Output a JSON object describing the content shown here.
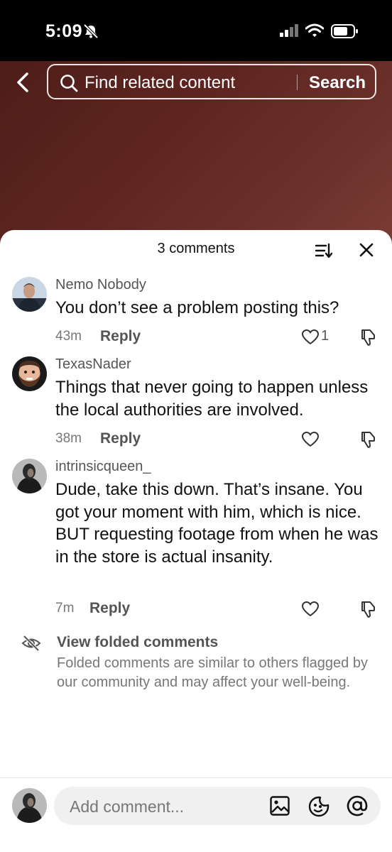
{
  "status_bar": {
    "time": "5:09"
  },
  "search": {
    "placeholder": "Find related content",
    "button_label": "Search"
  },
  "comments_panel": {
    "title": "3 comments",
    "comments": [
      {
        "username": "Nemo Nobody",
        "text": "You don’t see a problem posting this?",
        "time": "43m",
        "reply_label": "Reply",
        "likes": "1"
      },
      {
        "username": "TexasNader",
        "text": "Things that never going to happen unless the local authorities are involved.",
        "time": "38m",
        "reply_label": "Reply",
        "likes": ""
      },
      {
        "username": "intrinsicqueen_",
        "text": "Dude, take this down. That’s insane. You got your moment with him, which is nice. BUT requesting footage from when he was in the store is actual insanity.",
        "time": "7m",
        "reply_label": "Reply",
        "likes": ""
      }
    ],
    "folded": {
      "title": "View folded comments",
      "description": "Folded comments are similar to others flagged by our community and may affect your well-being."
    }
  },
  "composer": {
    "placeholder": "Add comment..."
  },
  "colors": {
    "video_bg": "#5e2520",
    "sheet_bg": "#ffffff",
    "input_bg": "#f0f0f0",
    "text_primary": "#111111",
    "text_secondary": "#777777"
  },
  "icons": [
    "bell-slash-icon",
    "signal-icon",
    "wifi-icon",
    "battery-icon",
    "back-chevron-icon",
    "search-icon",
    "sort-icon",
    "close-icon",
    "heart-icon",
    "dislike-icon",
    "eye-slash-icon",
    "image-icon",
    "emoji-icon",
    "mention-icon"
  ]
}
